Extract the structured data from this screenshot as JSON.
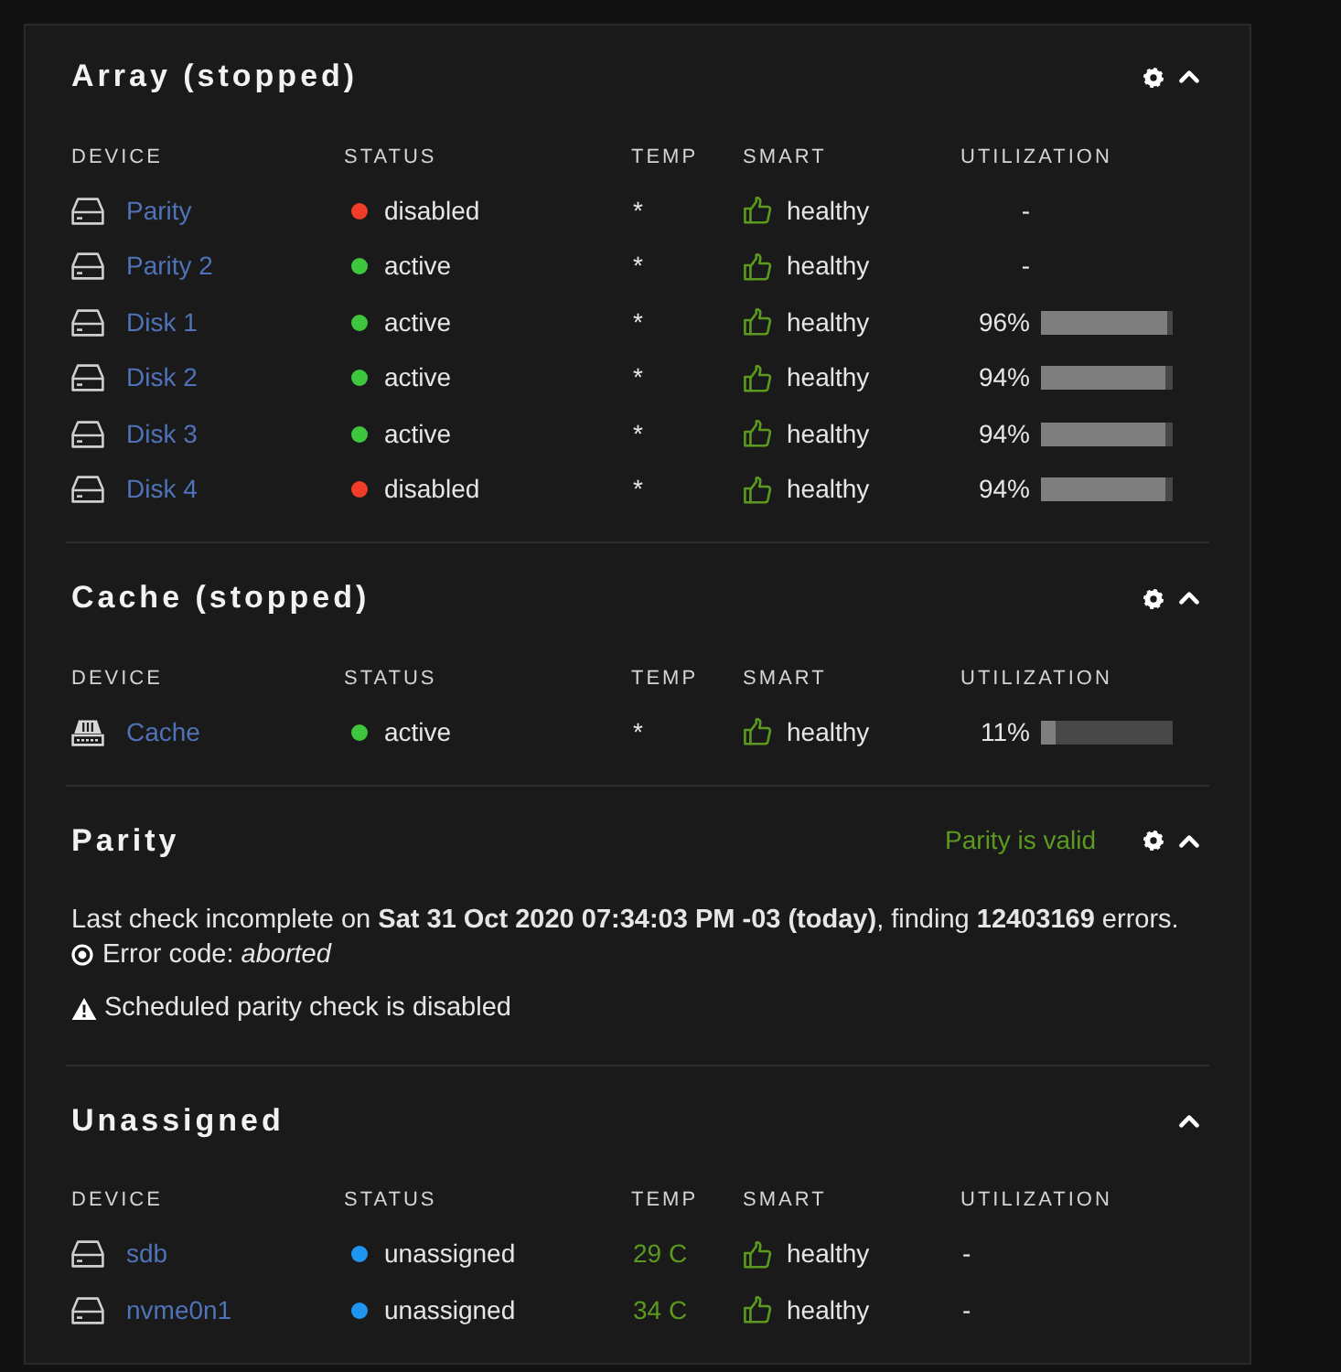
{
  "sections": [
    {
      "kind": "devices",
      "title": "Array (stopped)",
      "settings": true,
      "expanded": true,
      "columns": [
        "DEVICE",
        "STATUS",
        "TEMP",
        "SMART",
        "UTILIZATION"
      ],
      "rows": [
        {
          "kind": "disk",
          "device": "Parity",
          "status": {
            "text": "disabled",
            "color": "#f03c28"
          },
          "temp": {
            "text": "*"
          },
          "smart": "healthy",
          "utilization": {
            "kind": "dash",
            "reading": "-"
          }
        },
        {
          "kind": "disk",
          "device": "Parity 2",
          "status": {
            "text": "active",
            "color": "#3ec63e"
          },
          "temp": {
            "text": "*"
          },
          "smart": "healthy",
          "utilization": {
            "kind": "dash",
            "reading": "-"
          }
        },
        {
          "kind": "disk",
          "device": "Disk 1",
          "status": {
            "text": "active",
            "color": "#3ec63e"
          },
          "temp": {
            "text": "*"
          },
          "smart": "healthy",
          "utilization": {
            "kind": "meter",
            "reading": "96%",
            "level": 0.96
          }
        },
        {
          "kind": "disk",
          "device": "Disk 2",
          "status": {
            "text": "active",
            "color": "#3ec63e"
          },
          "temp": {
            "text": "*"
          },
          "smart": "healthy",
          "utilization": {
            "kind": "meter",
            "reading": "94%",
            "level": 0.94
          }
        },
        {
          "kind": "disk",
          "device": "Disk 3",
          "status": {
            "text": "active",
            "color": "#3ec63e"
          },
          "temp": {
            "text": "*"
          },
          "smart": "healthy",
          "utilization": {
            "kind": "meter",
            "reading": "94%",
            "level": 0.94
          }
        },
        {
          "kind": "disk",
          "device": "Disk 4",
          "status": {
            "text": "disabled",
            "color": "#f03c28"
          },
          "temp": {
            "text": "*"
          },
          "smart": "healthy",
          "utilization": {
            "kind": "meter",
            "reading": "94%",
            "level": 0.94
          }
        }
      ]
    },
    {
      "kind": "devices",
      "title": "Cache (stopped)",
      "settings": true,
      "expanded": true,
      "columns": [
        "DEVICE",
        "STATUS",
        "TEMP",
        "SMART",
        "UTILIZATION"
      ],
      "rows": [
        {
          "kind": "cache",
          "device": "Cache",
          "status": {
            "text": "active",
            "color": "#3ec63e"
          },
          "temp": {
            "text": "*"
          },
          "smart": "healthy",
          "utilization": {
            "kind": "meter",
            "reading": "11%",
            "level": 0.11
          }
        }
      ]
    },
    {
      "kind": "notes",
      "title": "Parity",
      "badge": "Parity is valid",
      "settings": true,
      "expanded": true,
      "lines": [
        {
          "kind": "plain",
          "text": "Last check incomplete on **Sat 31 Oct 2020 07:34:03 PM -03 (today)**, finding **12403169** errors."
        },
        {
          "kind": "error",
          "text": "Error code: *aborted*"
        },
        {
          "kind": "warning",
          "text": "Scheduled parity check is disabled"
        }
      ]
    },
    {
      "kind": "devices",
      "title": "Unassigned",
      "settings": false,
      "expanded": true,
      "columns": [
        "DEVICE",
        "STATUS",
        "TEMP",
        "SMART",
        "UTILIZATION"
      ],
      "rows": [
        {
          "kind": "disk",
          "device": "sdb",
          "status": {
            "text": "unassigned",
            "color": "#1e96f0"
          },
          "temp": {
            "text": "29 C",
            "color": "#5b9a1f"
          },
          "smart": "healthy",
          "utilization": {
            "kind": "plain",
            "reading": "-"
          }
        },
        {
          "kind": "disk",
          "device": "nvme0n1",
          "status": {
            "text": "unassigned",
            "color": "#1e96f0"
          },
          "temp": {
            "text": "34 C",
            "color": "#5b9a1f"
          },
          "smart": "healthy",
          "utilization": {
            "kind": "plain",
            "reading": "-"
          }
        }
      ]
    }
  ]
}
